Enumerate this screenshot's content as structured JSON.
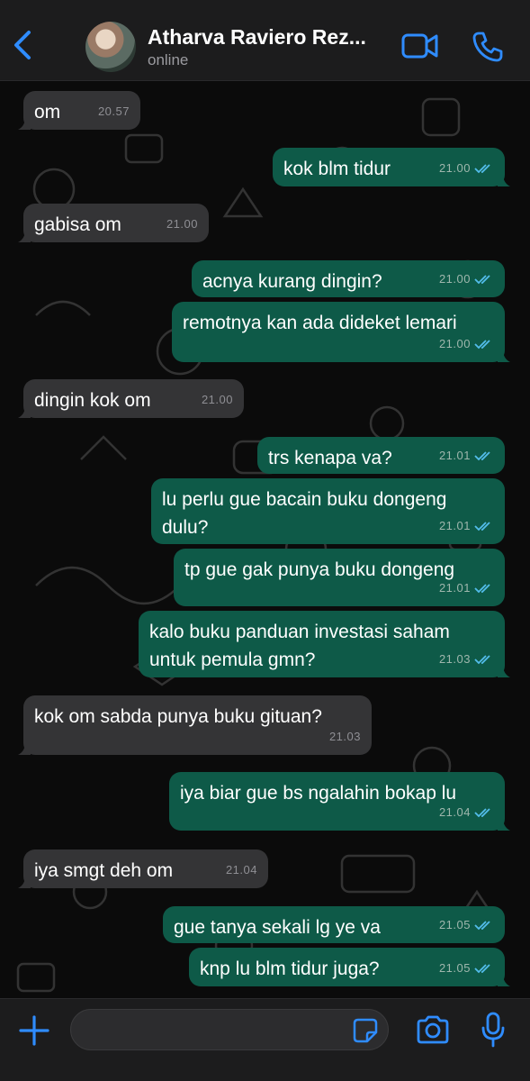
{
  "header": {
    "name": "Atharva Raviero Rez...",
    "status": "online"
  },
  "colors": {
    "accent": "#2f8cff",
    "incoming_bubble": "#343436",
    "outgoing_bubble": "#0e5a48",
    "read_tick": "#53bdeb"
  },
  "icons": [
    "chevron-left-icon",
    "video-camera-icon",
    "phone-icon",
    "plus-icon",
    "sticker-icon",
    "camera-icon",
    "microphone-icon",
    "double-check-icon"
  ],
  "messages": [
    {
      "dir": "in",
      "text": "om",
      "time": "20.57"
    },
    {
      "dir": "out",
      "text": "kok blm tidur",
      "time": "21.00",
      "read": true
    },
    {
      "dir": "in",
      "text": "gabisa om",
      "time": "21.00"
    },
    {
      "dir": "out",
      "text": "acnya kurang dingin?",
      "time": "21.00",
      "read": true
    },
    {
      "dir": "out",
      "text": "remotnya kan ada dideket lemari",
      "time": "21.00",
      "read": true
    },
    {
      "dir": "in",
      "text": "dingin kok om",
      "time": "21.00"
    },
    {
      "dir": "out",
      "text": "trs kenapa va?",
      "time": "21.01",
      "read": true
    },
    {
      "dir": "out",
      "text": "lu perlu gue bacain buku dongeng dulu?",
      "time": "21.01",
      "read": true
    },
    {
      "dir": "out",
      "text": "tp gue gak punya buku dongeng",
      "time": "21.01",
      "read": true
    },
    {
      "dir": "out",
      "text": "kalo buku panduan investasi saham untuk pemula gmn?",
      "time": "21.03",
      "read": true
    },
    {
      "dir": "in",
      "text": "kok om sabda punya buku gituan?",
      "time": "21.03"
    },
    {
      "dir": "out",
      "text": "iya biar gue bs ngalahin bokap lu",
      "time": "21.04",
      "read": true
    },
    {
      "dir": "in",
      "text": "iya smgt deh om",
      "time": "21.04"
    },
    {
      "dir": "out",
      "text": "gue tanya sekali lg ye va",
      "time": "21.05",
      "read": true
    },
    {
      "dir": "out",
      "text": "knp lu blm tidur juga?",
      "time": "21.05",
      "read": true
    }
  ],
  "composer": {
    "value": ""
  }
}
